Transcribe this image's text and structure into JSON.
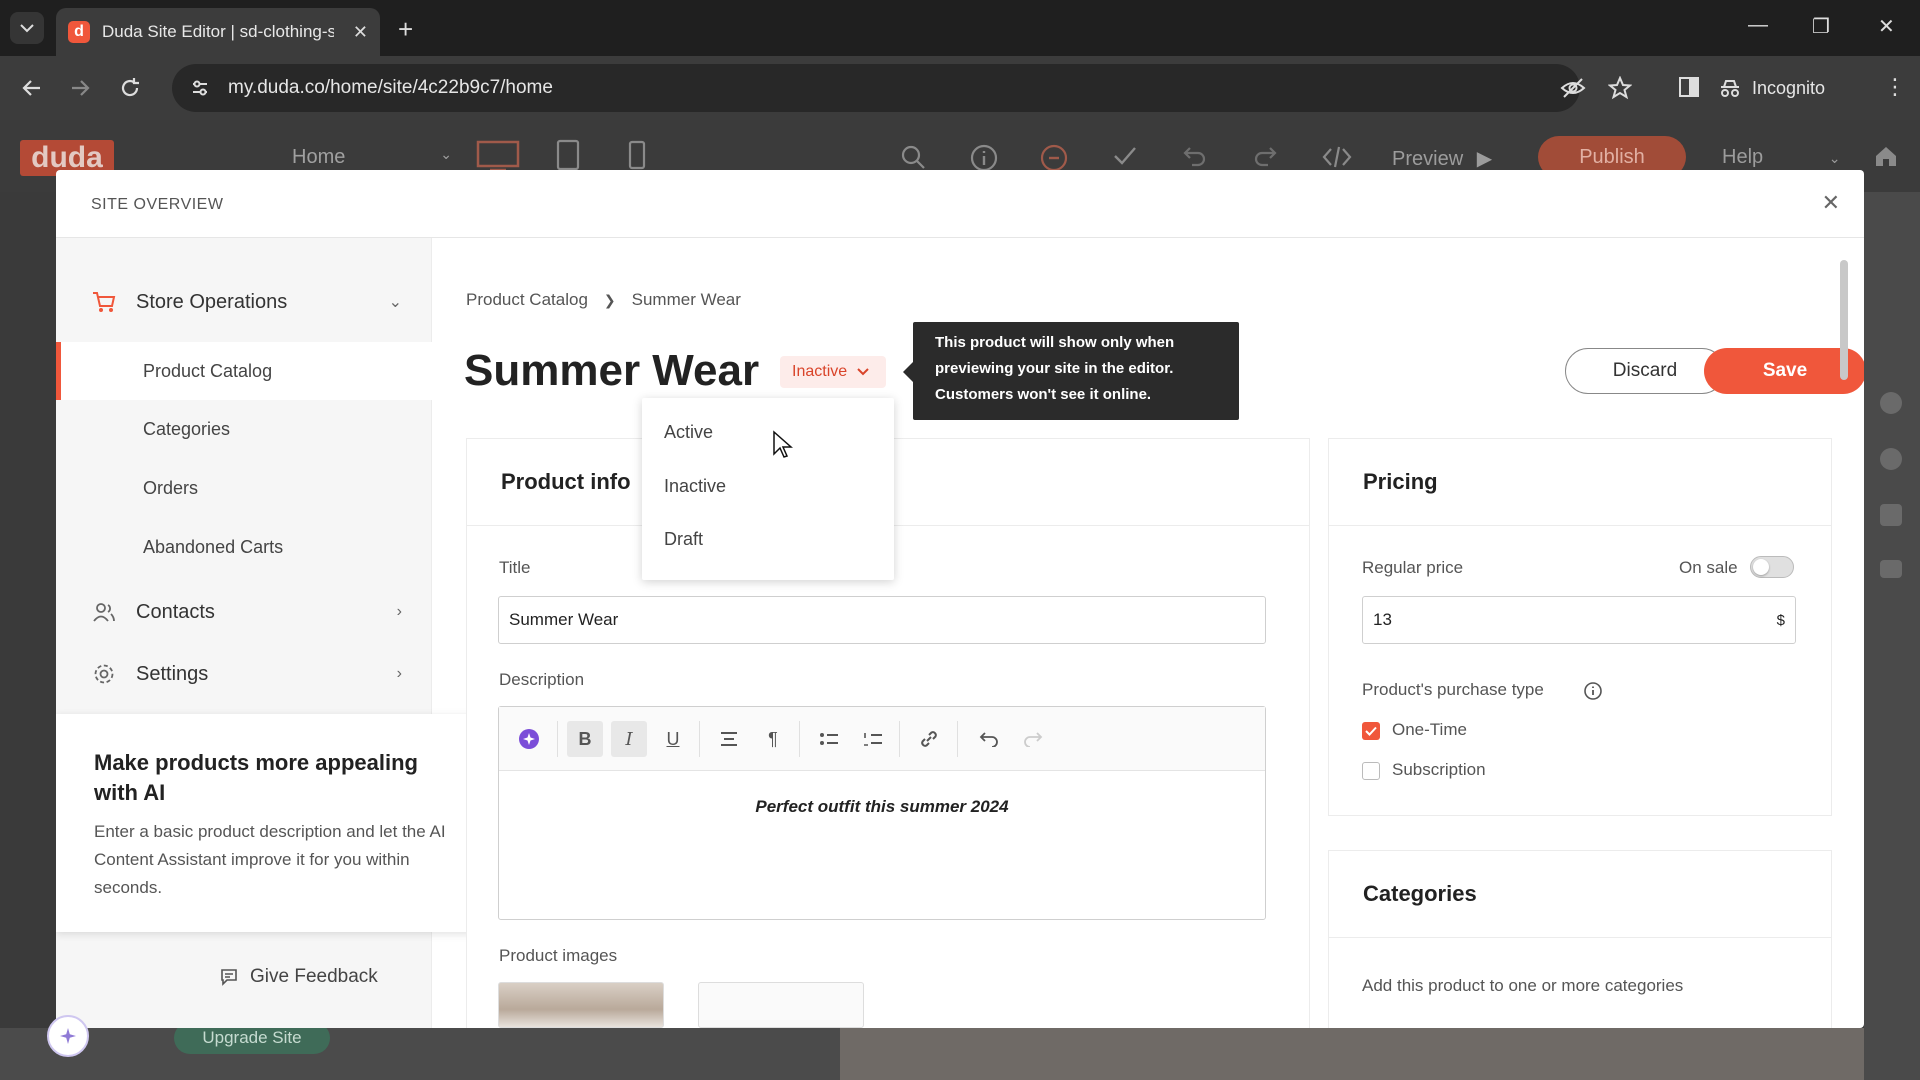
{
  "browser": {
    "tab_title": "Duda Site Editor | sd-clothing-s",
    "favicon_letter": "d",
    "url": "my.duda.co/home/site/4c22b9c7/home",
    "incognito_label": "Incognito"
  },
  "duda_bar": {
    "logo": "duda",
    "page_selector": "Home",
    "preview_label": "Preview",
    "publish_label": "Publish",
    "help_label": "Help",
    "upgrade_label": "Upgrade Site"
  },
  "modal": {
    "title": "SITE OVERVIEW"
  },
  "sidebar": {
    "store_operations": "Store Operations",
    "sub_items": [
      "Product Catalog",
      "Categories",
      "Orders",
      "Abandoned Carts"
    ],
    "contacts": "Contacts",
    "settings": "Settings",
    "give_feedback": "Give Feedback"
  },
  "ai_card": {
    "title": "Make products more appealing with AI",
    "text": "Enter a basic product description and let the AI Content Assistant improve it for you within seconds."
  },
  "breadcrumb": {
    "parent": "Product Catalog",
    "current": "Summer Wear"
  },
  "product": {
    "title": "Summer Wear",
    "status": "Inactive",
    "tooltip": "This product will show only when previewing your site in the editor. Customers won't see it online.",
    "discard_label": "Discard",
    "save_label": "Save"
  },
  "status_options": [
    "Active",
    "Inactive",
    "Draft"
  ],
  "product_info": {
    "heading": "Product info",
    "title_label": "Title",
    "title_value": "Summer Wear",
    "description_label": "Description",
    "description_value": "Perfect outfit this summer 2024",
    "images_label": "Product images"
  },
  "pricing": {
    "heading": "Pricing",
    "regular_price_label": "Regular price",
    "on_sale_label": "On sale",
    "on_sale": false,
    "price_value": "13",
    "currency": "$",
    "purchase_type_label": "Product's purchase type",
    "one_time_label": "One-Time",
    "one_time_checked": true,
    "subscription_label": "Subscription",
    "subscription_checked": false
  },
  "categories": {
    "heading": "Categories",
    "hint": "Add this product to one or more categories"
  },
  "colors": {
    "accent": "#f0573b",
    "tooltip_bg": "#2b2b2b"
  }
}
